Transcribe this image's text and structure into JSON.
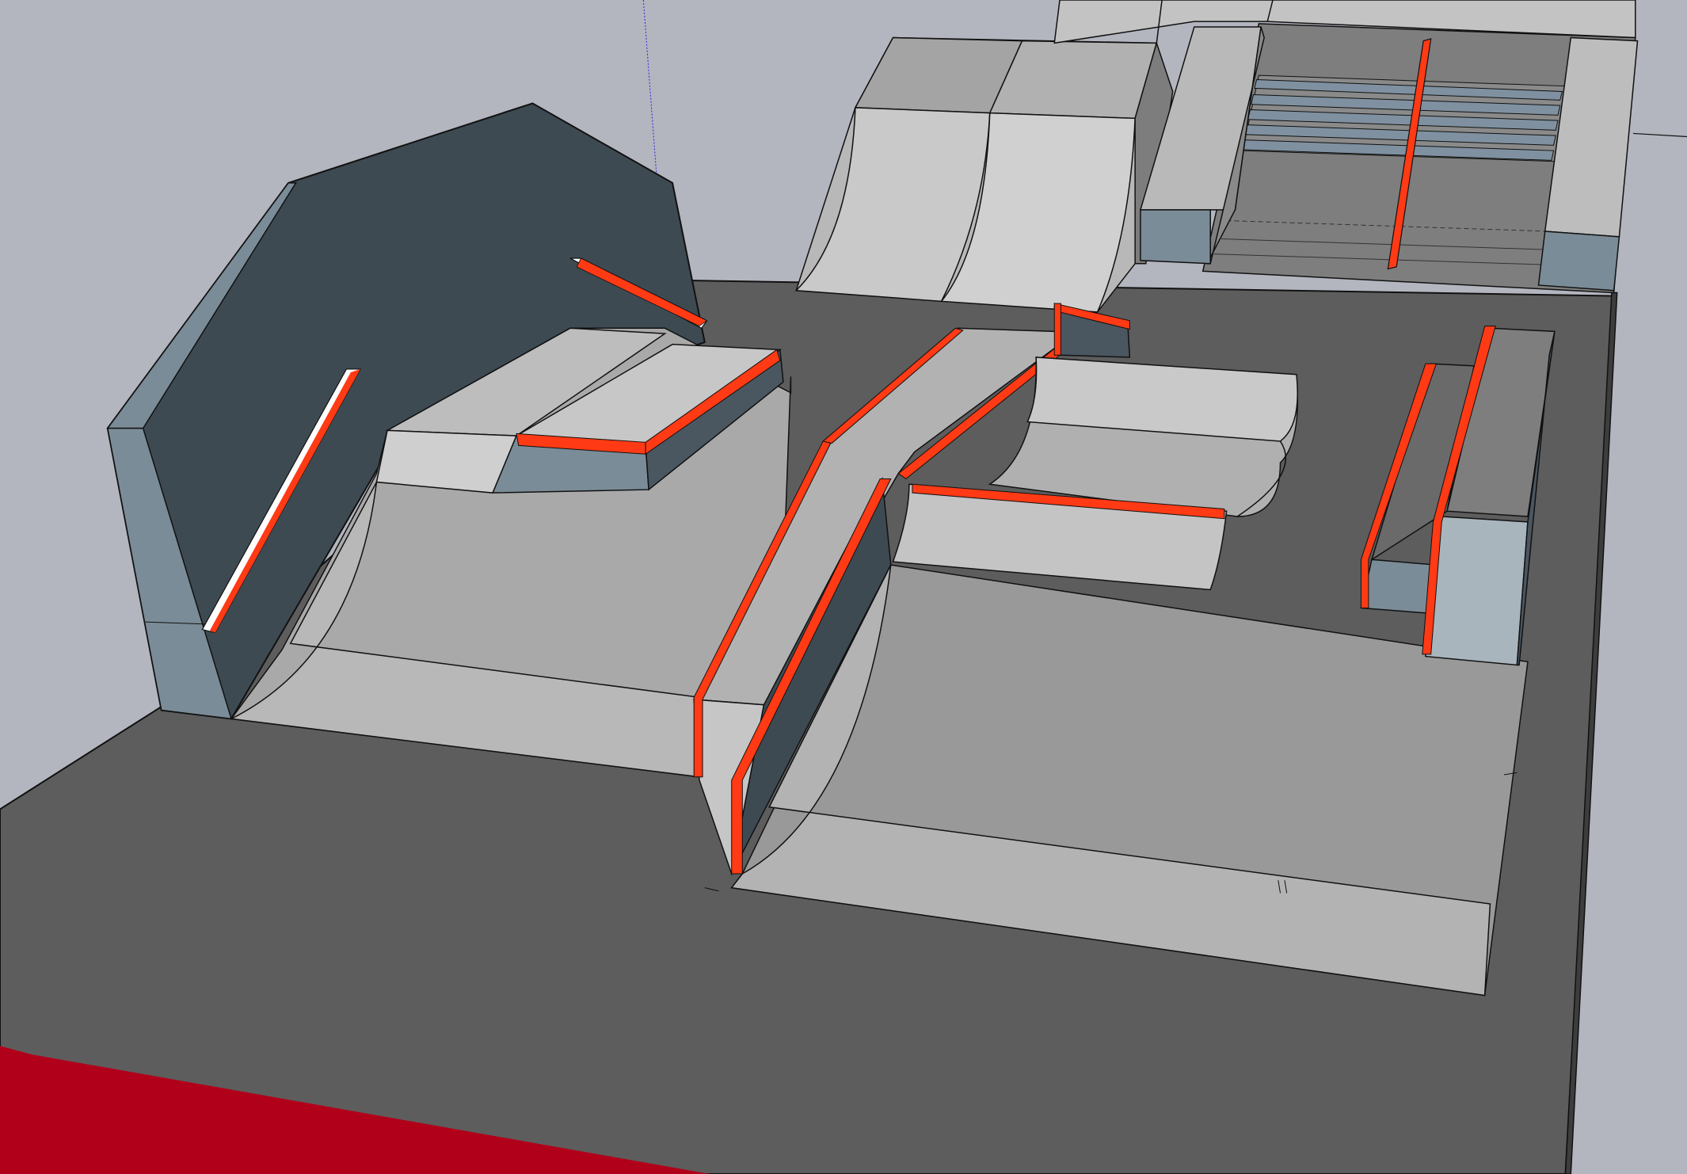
{
  "app": {
    "view": "3d-model-viewport"
  },
  "colors": {
    "sky": "#b3b5bf",
    "ground": "#5d5d5d",
    "wall_dark": "#3e4a52",
    "wall_edge": "#7a8c97",
    "surface_light": "#c4c4c4",
    "surface_mid": "#a9a9a9",
    "surface_dark": "#8e8e8e",
    "box_face": "#7a8c97",
    "accent_orange": "#ff3a14",
    "accent_red_floor": "#b1001a",
    "outline": "#111111",
    "axis_blue": "#2a2ad8"
  },
  "objects": [
    "angled-backwall",
    "wall-rail-left",
    "wall-rail-top",
    "left-bank-ramp",
    "funbox-ledge",
    "quarterpipe-back",
    "stair-set",
    "handrail-stairs",
    "center-hubba-ledge",
    "center-bank",
    "curved-spine",
    "manual-pad",
    "right-ledges",
    "red-floor-strip"
  ]
}
